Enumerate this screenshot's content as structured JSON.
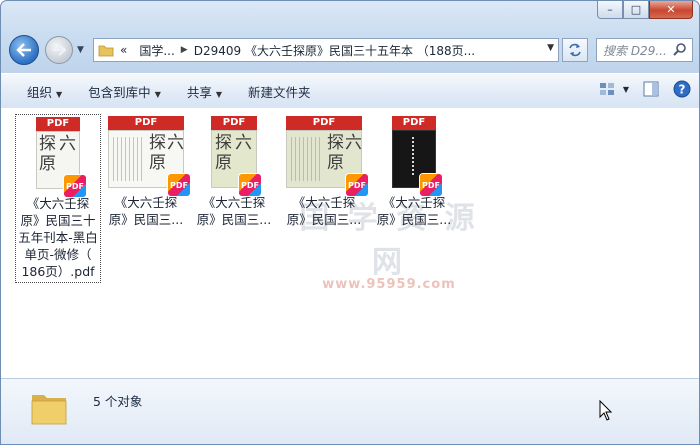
{
  "window": {
    "caption_buttons": {
      "minimize": "–",
      "maximize": "□",
      "close": "✕"
    }
  },
  "address_bar": {
    "root": "«",
    "segments": [
      "国学...",
      "D29409 《大六壬探原》民国三十五年本 （188页..."
    ],
    "refresh_icon": "refresh-arrows-icon",
    "search_placeholder": "搜索 D29..."
  },
  "toolbar": {
    "organize": "组织",
    "include_in_library": "包含到库中",
    "share": "共享",
    "new_folder": "新建文件夹"
  },
  "files": [
    {
      "name_lines": [
        "《大六壬探",
        "原》民国三十",
        "五年刊本-黑白",
        "单页-微修（",
        "186页）.pdf"
      ],
      "selected": true,
      "pdf_label": "PDF",
      "badge": "PDF"
    },
    {
      "name_lines": [
        "《大六壬探",
        "原》民国三..."
      ],
      "selected": false,
      "pdf_label": "PDF",
      "badge": "PDF"
    },
    {
      "name_lines": [
        "《大六壬探",
        "原》民国三..."
      ],
      "selected": false,
      "pdf_label": "PDF",
      "badge": "PDF"
    },
    {
      "name_lines": [
        "《大六壬探",
        "原》民国三..."
      ],
      "selected": false,
      "pdf_label": "PDF",
      "badge": "PDF"
    },
    {
      "name_lines": [
        "《大六壬探",
        "原》民国三..."
      ],
      "selected": false,
      "pdf_label": "PDF",
      "badge": "PDF"
    }
  ],
  "watermark": {
    "text": "国 学 资 源 网",
    "url": "www.95959.com"
  },
  "details": {
    "item_count": "5 个对象"
  }
}
